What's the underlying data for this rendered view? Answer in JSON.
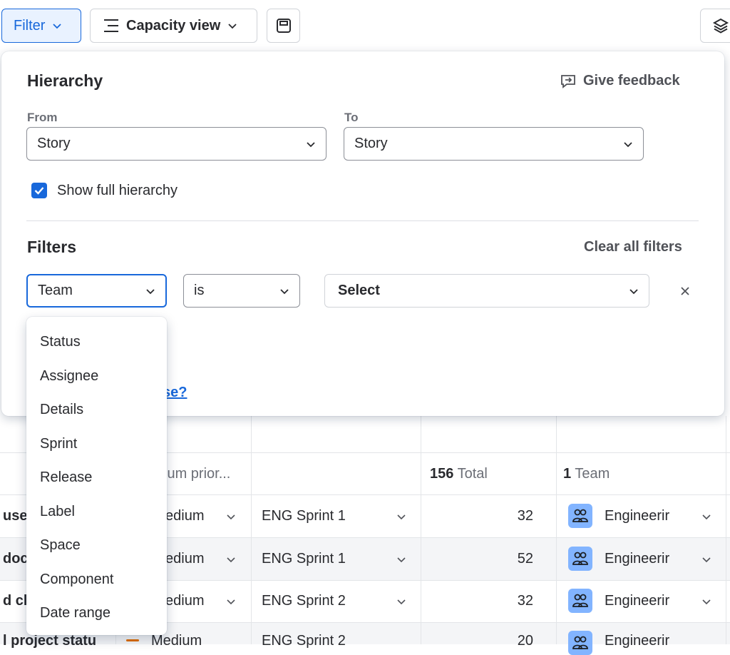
{
  "toolbar": {
    "filter_label": "Filter",
    "capacity_label": "Capacity view"
  },
  "panel": {
    "hierarchy_title": "Hierarchy",
    "feedback_label": "Give feedback",
    "from_label": "From",
    "to_label": "To",
    "from_value": "Story",
    "to_value": "Story",
    "show_full_label": "Show full hierarchy",
    "filters_title": "Filters",
    "clear_all_label": "Clear all filters",
    "filter_field_value": "Team",
    "operator_value": "is",
    "value_placeholder": "Select",
    "partial_link": "se?"
  },
  "dropdown": {
    "items": [
      "Status",
      "Assignee",
      "Details",
      "Sprint",
      "Release",
      "Label",
      "Space",
      "Component",
      "Date range"
    ]
  },
  "table": {
    "summary": {
      "priority": "ium prior...",
      "total_num": "156",
      "total_label": "Total",
      "team_num": "1",
      "team_label": "Team"
    },
    "rows": [
      {
        "name": "use",
        "priority": "edium",
        "sprint": "ENG Sprint 1",
        "points": "32",
        "team": "Engineerir"
      },
      {
        "name": "doc",
        "priority": "edium",
        "sprint": "ENG Sprint 1",
        "points": "52",
        "team": "Engineerir"
      },
      {
        "name": "d cli",
        "priority": "edium",
        "sprint": "ENG Sprint 2",
        "points": "32",
        "team": "Engineerir"
      },
      {
        "name": "l project statu",
        "priority": "Medium",
        "sprint": "ENG Sprint 2",
        "points": "20",
        "team": "Engineerir"
      }
    ]
  },
  "colors": {
    "accent": "#1868db",
    "checkbox": "#1868db",
    "avatar": "#82b4ff",
    "row_shade": "#f4f5f7"
  }
}
